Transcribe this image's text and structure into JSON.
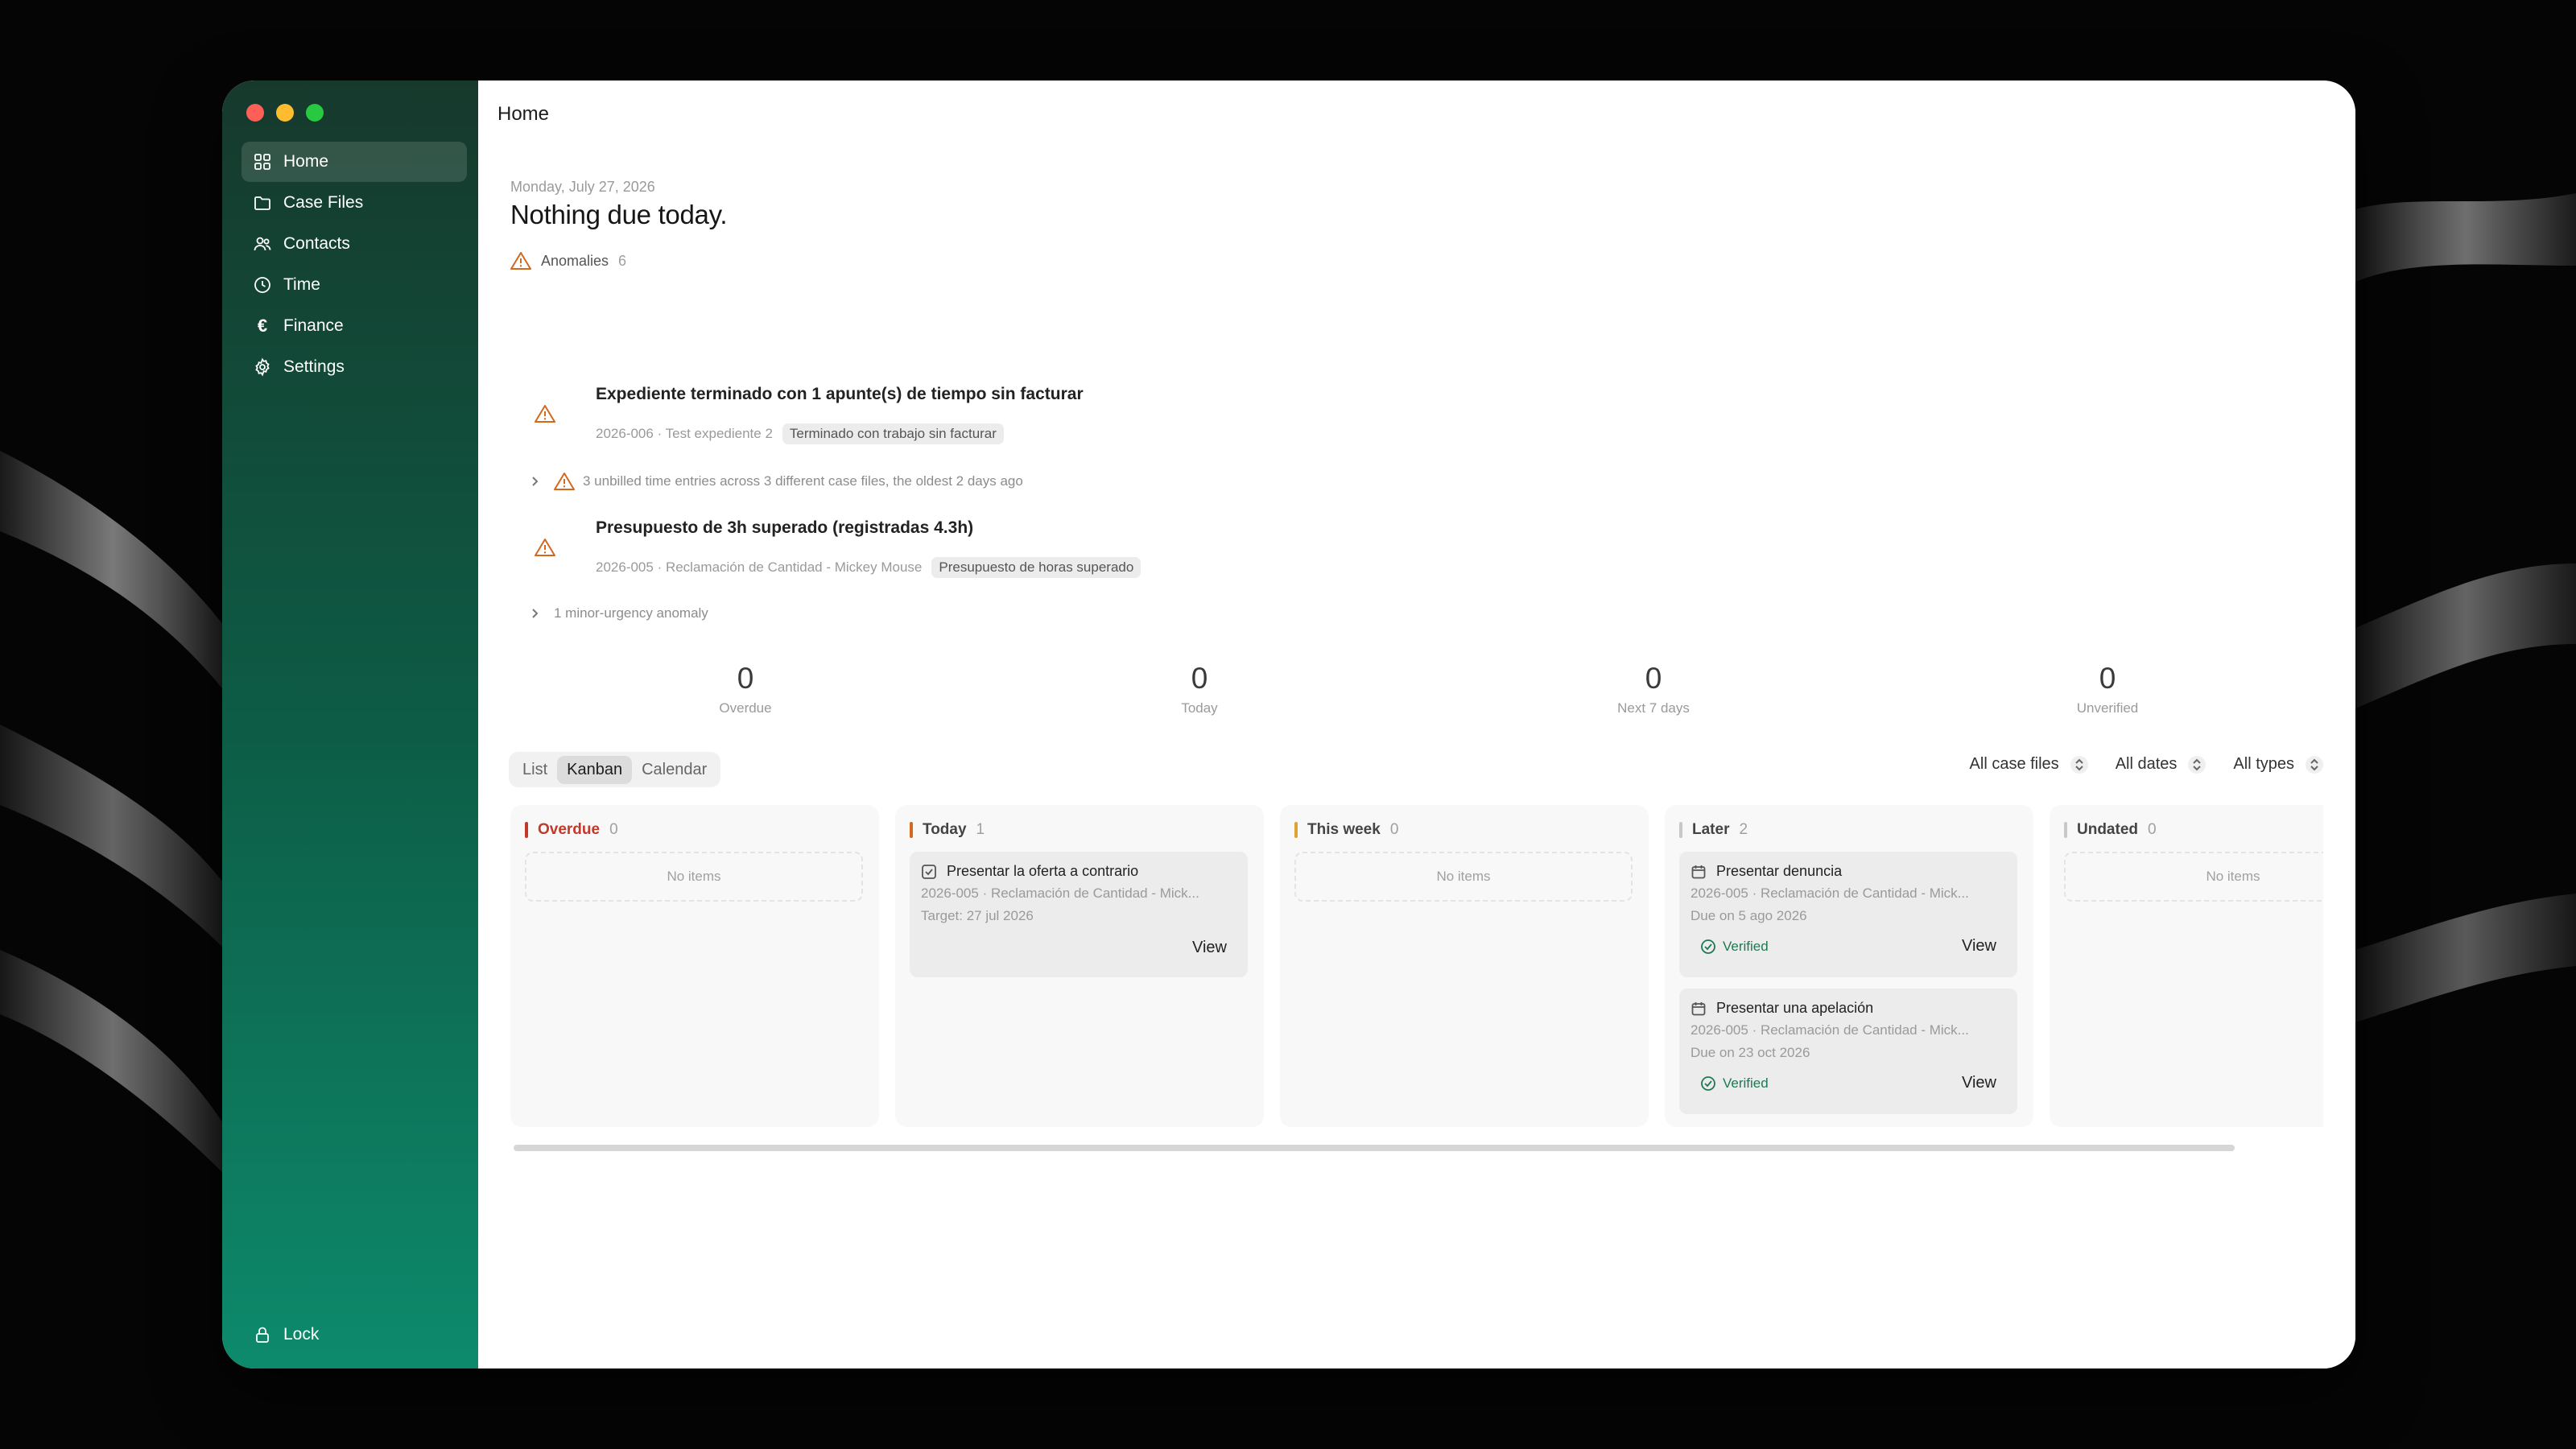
{
  "colors": {
    "sidebar_top": "#16392c",
    "sidebar_bottom": "#0d8a6c",
    "overdue": "#c0392b",
    "today": "#d2691e",
    "this_week": "#e0a234",
    "later": "#c8c8c8",
    "undated": "#c8c8c8",
    "verified": "#1e7a52",
    "warning": "#d2691e"
  },
  "sidebar": {
    "items": [
      {
        "label": "Home",
        "icon": "grid-icon"
      },
      {
        "label": "Case Files",
        "icon": "folder-icon"
      },
      {
        "label": "Contacts",
        "icon": "users-icon"
      },
      {
        "label": "Time",
        "icon": "clock-icon"
      },
      {
        "label": "Finance",
        "icon": "euro-icon"
      },
      {
        "label": "Settings",
        "icon": "gear-icon"
      }
    ],
    "lock_label": "Lock"
  },
  "header": {
    "title": "Home"
  },
  "main": {
    "date": "Monday, July 27, 2026",
    "headline": "Nothing due today.",
    "anomalies": {
      "label": "Anomalies",
      "count": "6",
      "items": [
        {
          "title": "Expediente terminado con 1 apunte(s) de tiempo sin facturar",
          "meta": "2026-006 · Test expediente 2",
          "tag": "Terminado con trabajo sin facturar"
        },
        {
          "title": "Presupuesto de 3h superado (registradas 4.3h)",
          "meta": "2026-005 · Reclamación de Cantidad - Mickey Mouse",
          "tag": "Presupuesto de horas superado"
        }
      ],
      "collapsed_unbilled": "3 unbilled time entries across 3 different case files, the oldest 2 days ago",
      "collapsed_minor": "1 minor-urgency anomaly"
    },
    "stats": [
      {
        "value": "0",
        "label": "Overdue"
      },
      {
        "value": "0",
        "label": "Today"
      },
      {
        "value": "0",
        "label": "Next 7 days"
      },
      {
        "value": "0",
        "label": "Unverified"
      }
    ],
    "view_tabs": [
      "List",
      "Kanban",
      "Calendar"
    ],
    "active_view": "Kanban",
    "filters": [
      "All case files",
      "All dates",
      "All types"
    ]
  },
  "board": {
    "no_items": "No items",
    "view_label": "View",
    "verified_label": "Verified",
    "columns": [
      {
        "name": "Overdue",
        "count": "0"
      },
      {
        "name": "Today",
        "count": "1"
      },
      {
        "name": "This week",
        "count": "0"
      },
      {
        "name": "Later",
        "count": "2"
      },
      {
        "name": "Undated",
        "count": "0"
      }
    ],
    "today_cards": [
      {
        "title": "Presentar la oferta a contrario",
        "case": "2026-005 · Reclamación de Cantidad - Mick...",
        "date": "Target: 27 jul 2026"
      }
    ],
    "later_cards": [
      {
        "title": "Presentar denuncia",
        "case": "2026-005 · Reclamación de Cantidad - Mick...",
        "date": "Due on 5 ago 2026"
      },
      {
        "title": "Presentar una apelación",
        "case": "2026-005 · Reclamación de Cantidad - Mick...",
        "date": "Due on 23 oct 2026"
      }
    ]
  }
}
